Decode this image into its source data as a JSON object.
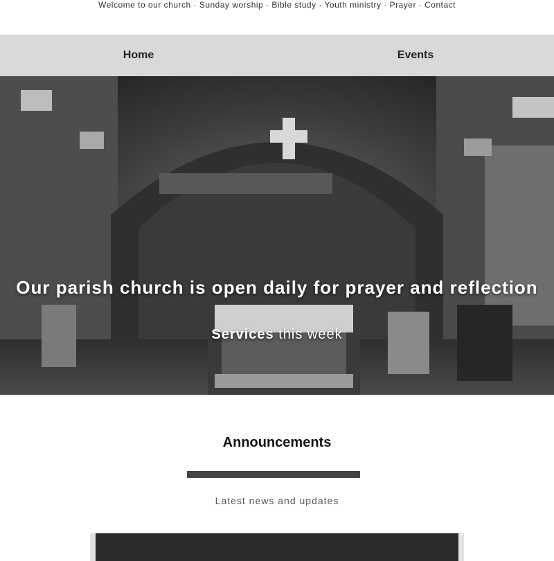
{
  "topbar": {
    "text": "Welcome to our church · Sunday worship · Bible study · Youth ministry · Prayer · Contact"
  },
  "tabs": [
    {
      "label": "Home"
    },
    {
      "label": "Events"
    }
  ],
  "hero": {
    "title": "Our parish church is open daily for prayer and reflection",
    "subtitle_bold": "Services",
    "subtitle_rest": " this week"
  },
  "section": {
    "heading": "Announcements",
    "caption": "Latest news and updates"
  }
}
